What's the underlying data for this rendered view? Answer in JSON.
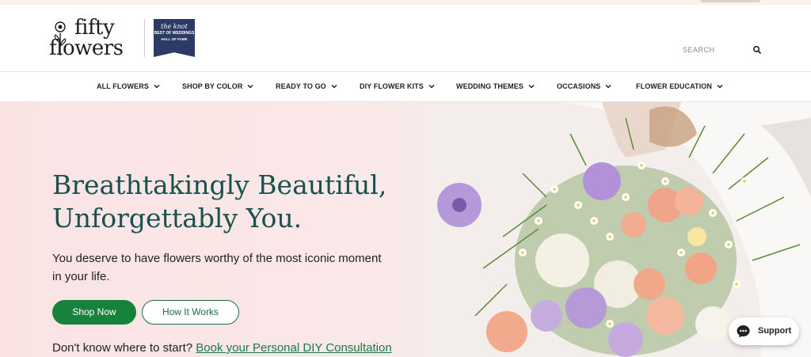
{
  "brand": {
    "logo_line1": "fifty",
    "logo_line2": "flowers",
    "badge_line1": "the knot",
    "badge_line2": "BEST OF WEDDINGS",
    "badge_line3": "HALL OF FAME"
  },
  "search": {
    "placeholder": "SEARCH"
  },
  "nav": {
    "items": [
      {
        "label": "ALL FLOWERS"
      },
      {
        "label": "SHOP BY COLOR"
      },
      {
        "label": "READY TO GO"
      },
      {
        "label": "DIY FLOWER KITS"
      },
      {
        "label": "WEDDING THEMES"
      },
      {
        "label": "OCCASIONS"
      },
      {
        "label": "FLOWER EDUCATION"
      }
    ]
  },
  "hero": {
    "headline_line1": "Breathtakingly Beautiful,",
    "headline_line2": "Unforgettably You.",
    "subtext": "You deserve to have flowers worthy of the most iconic moment in your life.",
    "shop_now": "Shop Now",
    "how_it_works": "How It Works",
    "consult_prefix": "Don't know where to start?",
    "consult_link": "Book your Personal DIY Consultation"
  },
  "support": {
    "label": "Support"
  },
  "colors": {
    "accent_green": "#17823c",
    "headline_teal": "#17524e",
    "hero_pink": "#fbe5e6",
    "badge_navy": "#2c3a66"
  }
}
